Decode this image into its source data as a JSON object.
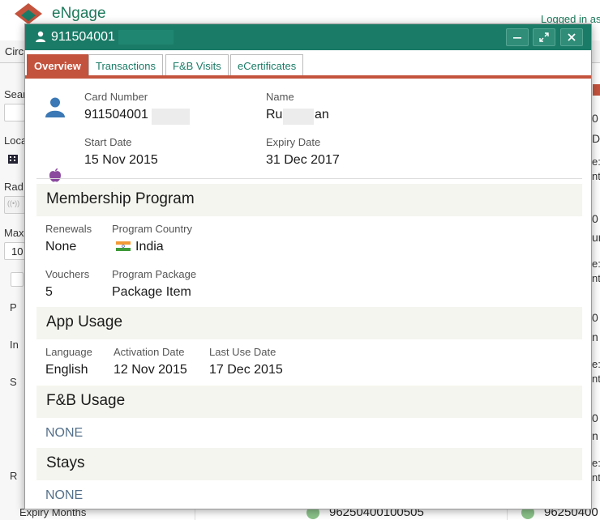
{
  "app": {
    "logo_text": "eNgage",
    "logged_in": "Logged in as",
    "nav_text": "Circ",
    "brand_colors": {
      "green": "#1a7b66",
      "red": "#c4533d"
    }
  },
  "sidebar": {
    "labels": [
      "Sear",
      "Loca",
      "Rad",
      "Max",
      "10",
      "P",
      "In",
      "S",
      "R",
      "Expiry Months"
    ]
  },
  "background_rows": {
    "card_a": "96250400100505",
    "card_b": "96250400"
  },
  "right_column": {
    "texts": [
      "0",
      "De",
      "e:",
      "nte",
      "0",
      "un",
      "e:",
      "nte",
      "0",
      "n",
      "e:",
      "nte",
      "0",
      "n",
      "e:",
      "nte"
    ]
  },
  "dialog": {
    "title": "911504001",
    "tabs": [
      "Overview",
      "Transactions",
      "F&B Visits",
      "eCertificates"
    ],
    "active_tab": "Overview",
    "card": {
      "card_number_label": "Card Number",
      "card_number": "911504001",
      "name_label": "Name",
      "name_prefix": "Ru",
      "name_suffix": "an",
      "start_date_label": "Start Date",
      "start_date": "15 Nov 2015",
      "expiry_date_label": "Expiry Date",
      "expiry_date": "31 Dec 2017",
      "icons": [
        "user-icon",
        "apple-icon"
      ]
    },
    "membership": {
      "title": "Membership Program",
      "renewals_label": "Renewals",
      "renewals": "None",
      "country_label": "Program Country",
      "country": "India",
      "vouchers_label": "Vouchers",
      "vouchers": "5",
      "package_label": "Program Package",
      "package": "Package Item"
    },
    "app_usage": {
      "title": "App Usage",
      "language_label": "Language",
      "language": "English",
      "activation_label": "Activation Date",
      "activation": "12 Nov 2015",
      "last_use_label": "Last Use Date",
      "last_use": "17 Dec 2015"
    },
    "fb_usage": {
      "title": "F&B Usage",
      "value": "NONE"
    },
    "stays": {
      "title": "Stays",
      "value": "NONE"
    }
  }
}
